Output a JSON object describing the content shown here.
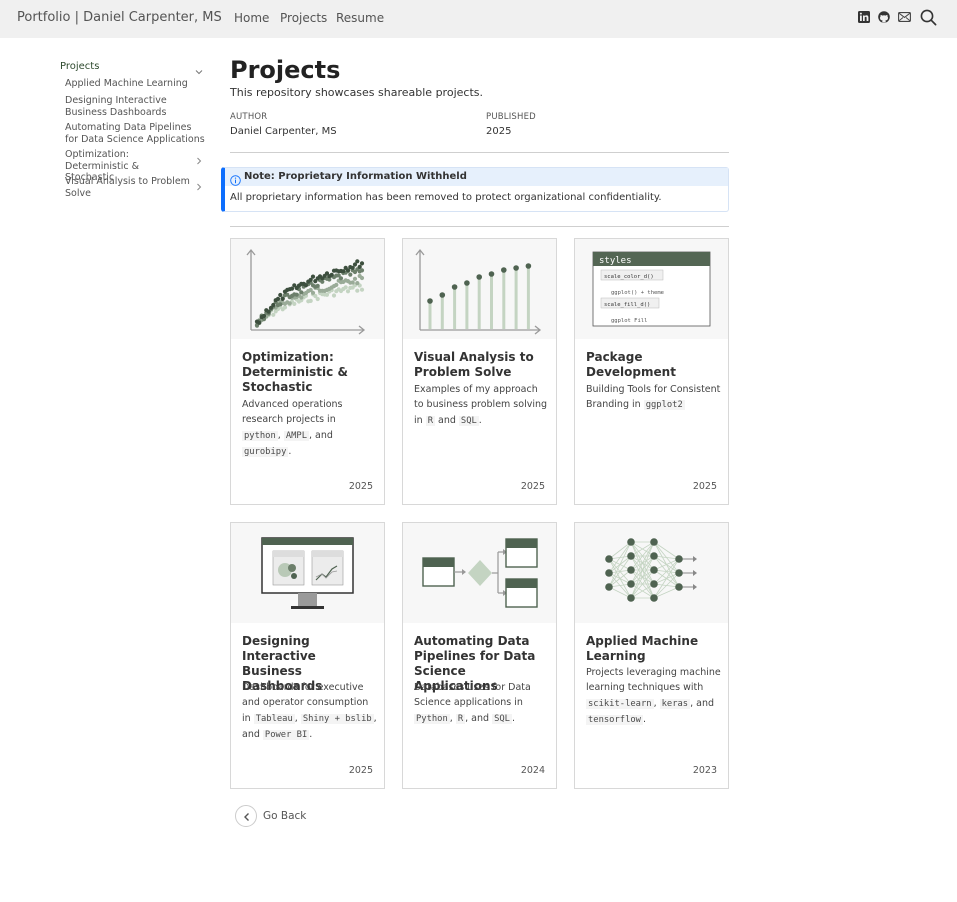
{
  "navbar": {
    "brand": "Portfolio | Daniel Carpenter, MS",
    "links": [
      "Home",
      "Projects",
      "Resume"
    ],
    "icons": [
      "linkedin-icon",
      "github-icon",
      "mail-icon",
      "search-icon"
    ]
  },
  "sidebar": {
    "section_label": "Projects",
    "items": [
      {
        "label": "Applied Machine Learning",
        "expandable": false
      },
      {
        "label": "Designing Interactive Business Dashboards",
        "expandable": false
      },
      {
        "label": "Automating Data Pipelines for Data Science Applications",
        "expandable": false
      },
      {
        "label": "Optimization: Deterministic & Stochastic",
        "expandable": true
      },
      {
        "label": "Visual Analysis to Problem Solve",
        "expandable": true
      }
    ]
  },
  "page": {
    "title": "Projects",
    "subtitle": "This repository showcases shareable projects.",
    "author_label": "AUTHOR",
    "author": "Daniel Carpenter, MS",
    "published_label": "PUBLISHED",
    "published": "2025"
  },
  "callout": {
    "title": "Note: Proprietary Information Withheld",
    "body": "All proprietary information has been removed to protect organizational confidentiality."
  },
  "cards": [
    {
      "title": "Optimization: Deterministic & Stochastic",
      "description": [
        {
          "text": "Advanced operations research projects in "
        },
        {
          "code": "python"
        },
        {
          "text": ", "
        },
        {
          "code": "AMPL"
        },
        {
          "text": ", and "
        },
        {
          "code": "gurobipy"
        },
        {
          "text": "."
        }
      ],
      "date": "2025",
      "image": "scatter-growth-chart-icon"
    },
    {
      "title": "Visual Analysis to Problem Solve",
      "description": [
        {
          "text": "Examples of my approach to business problem solving in "
        },
        {
          "code": "R"
        },
        {
          "text": " and "
        },
        {
          "code": "SQL"
        },
        {
          "text": "."
        }
      ],
      "date": "2025",
      "image": "lollipop-chart-icon"
    },
    {
      "title": "Package Development",
      "description": [
        {
          "text": "Building Tools for Consistent Branding in "
        },
        {
          "code": "ggplot2"
        }
      ],
      "date": "2025",
      "image": "code-styles-screenshot-icon"
    },
    {
      "title": "Designing Interactive Business Dashboards",
      "description": [
        {
          "text": "Dashboards for executive and operator consumption in "
        },
        {
          "code": "Tableau"
        },
        {
          "text": ", "
        },
        {
          "code": "Shiny + bslib"
        },
        {
          "text": ", and "
        },
        {
          "code": "Power BI"
        },
        {
          "text": "."
        }
      ],
      "date": "2025",
      "image": "dashboard-monitor-icon"
    },
    {
      "title": "Automating Data Pipelines for Data Science Applications",
      "description": [
        {
          "text": "Databases uses for Data Science applications in "
        },
        {
          "code": "Python"
        },
        {
          "text": ", "
        },
        {
          "code": "R"
        },
        {
          "text": ", and "
        },
        {
          "code": "SQL"
        },
        {
          "text": "."
        }
      ],
      "date": "2024",
      "image": "data-pipeline-diagram-icon"
    },
    {
      "title": "Applied Machine Learning",
      "description": [
        {
          "text": "Projects leveraging machine learning techniques with "
        },
        {
          "code": "scikit-learn"
        },
        {
          "text": ", "
        },
        {
          "code": "keras"
        },
        {
          "text": ", and "
        },
        {
          "code": "tensorflow"
        },
        {
          "text": "."
        }
      ],
      "date": "2023",
      "image": "neural-network-icon"
    }
  ],
  "card_image_text": {
    "styles_header": "styles",
    "code_lines": [
      "scale_color_d()",
      "ggplot() + theme",
      "scale_fill_d()",
      "ggplot Fill"
    ]
  },
  "go_back": {
    "label": "Go Back"
  },
  "colors": {
    "accent_green": "#4f6351",
    "light_green": "#c4d4c2",
    "callout_blue": "#0d6efd",
    "callout_bg": "#e6f0fc"
  }
}
